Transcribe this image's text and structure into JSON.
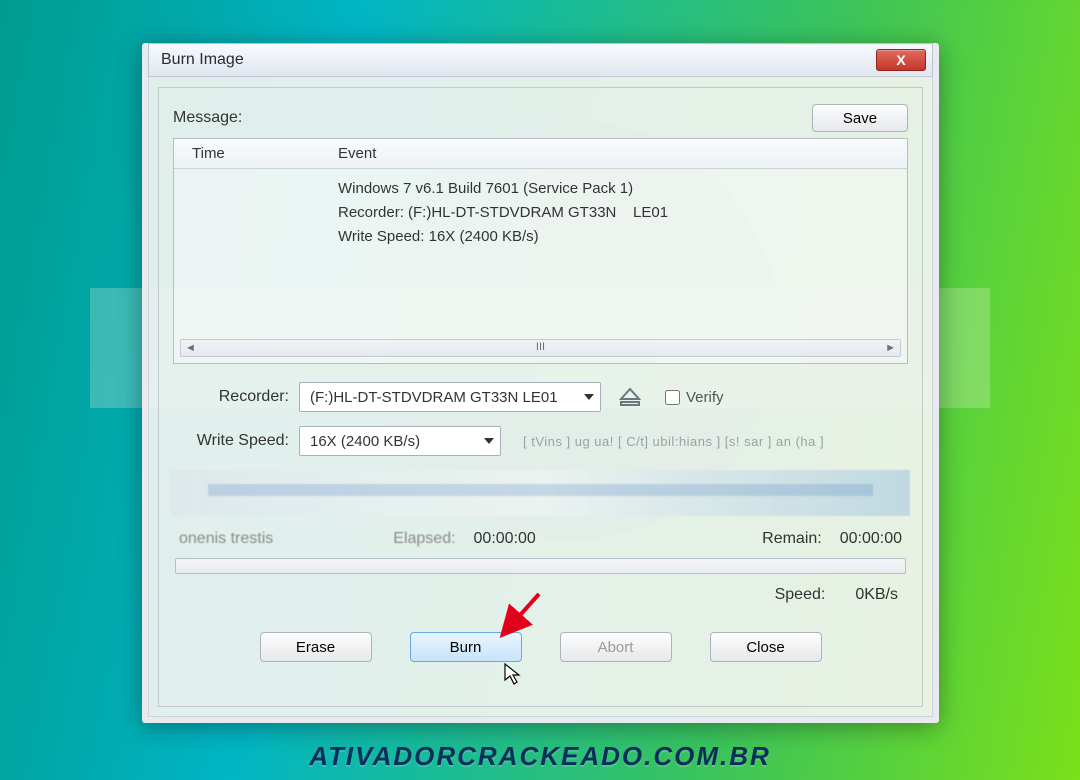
{
  "window": {
    "title": "Burn Image",
    "close_symbol": "X"
  },
  "labels": {
    "message": "Message:",
    "time_col": "Time",
    "event_col": "Event",
    "recorder": "Recorder:",
    "write_speed": "Write Speed:",
    "verify": "Verify",
    "elapsed": "Elapsed:",
    "remain": "Remain:",
    "speed": "Speed:"
  },
  "buttons": {
    "save": "Save",
    "erase": "Erase",
    "burn": "Burn",
    "abort": "Abort",
    "close": "Close"
  },
  "log": {
    "line1": "Windows 7 v6.1 Build 7601 (Service Pack 1)",
    "line2": "Recorder: (F:)HL-DT-STDVDRAM GT33N    LE01",
    "line3": "Write Speed: 16X (2400 KB/s)",
    "scroll_mid": "III"
  },
  "form": {
    "recorder_value": "(F:)HL-DT-STDVDRAM GT33N    LE01",
    "write_speed_value": "16X (2400 KB/s)",
    "blur_right": "[ tVins ] ug ua!   [ C/t] ubil:hians ] [s! sar ] an (ha ]"
  },
  "status": {
    "fuzzy_left": "onenis   trestis",
    "elapsed_value": "00:00:00",
    "remain_value": "00:00:00",
    "speed_value": "0KB/s"
  },
  "scroll_arrows": {
    "left": "◄",
    "right": "►"
  },
  "watermark": "ATIVADORCRACKEADO.COM.BR"
}
